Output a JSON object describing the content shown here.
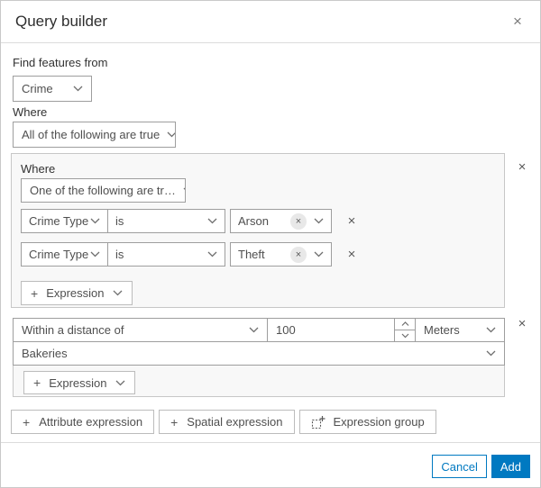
{
  "header": {
    "title": "Query builder",
    "close_icon": "×"
  },
  "find_from": {
    "label": "Find features from",
    "selected": "Crime"
  },
  "where": {
    "label": "Where",
    "selected": "All of the following are true"
  },
  "nested_group": {
    "label": "Where",
    "operator_selected": "One of the following are tr…",
    "conditions": [
      {
        "field": "Crime Type",
        "operator": "is",
        "value": "Arson",
        "chip_remove_icon": "×",
        "remove_icon": "×"
      },
      {
        "field": "Crime Type",
        "operator": "is",
        "value": "Theft",
        "chip_remove_icon": "×",
        "remove_icon": "×"
      }
    ],
    "add_expression": {
      "plus_sign": "+",
      "label": "Expression"
    },
    "remove_icon": "×"
  },
  "spatial_group": {
    "operator_selected": "Within a distance of",
    "distance_value": "100",
    "unit_selected": "Meters",
    "layer_selected": "Bakeries",
    "add_expression": {
      "plus_sign": "+",
      "label": "Expression"
    },
    "remove_icon": "×"
  },
  "actions": {
    "attribute_expression": {
      "plus_sign": "+",
      "label": "Attribute expression"
    },
    "spatial_expression": {
      "plus_sign": "+",
      "label": "Spatial expression"
    },
    "expression_group": {
      "icon": "expression-group-icon",
      "label": "Expression group"
    }
  },
  "footer": {
    "cancel": "Cancel",
    "add": "Add"
  },
  "colors": {
    "accent_blue": "#0079c1",
    "text": "#4c4c4c",
    "input_border": "#9e9e9e",
    "group_background": "#f8f8f8",
    "chip_background": "#e8e8e8"
  }
}
